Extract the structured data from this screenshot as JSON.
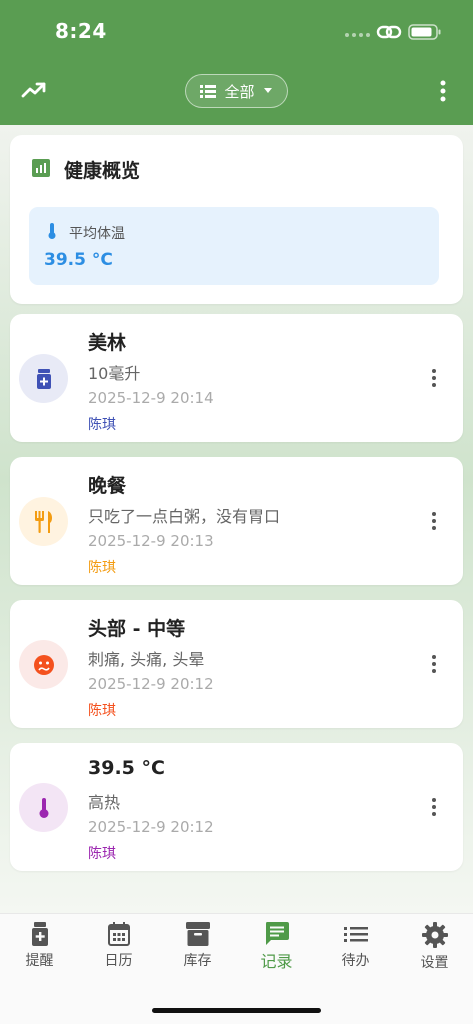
{
  "status_bar": {
    "time": "8:24"
  },
  "header": {
    "filter_label": "全部"
  },
  "overview": {
    "title": "健康概览",
    "avg_temp_label": "平均体温",
    "avg_temp_value": "39.5 °C"
  },
  "entries": [
    {
      "title": "美林",
      "desc": "10毫升",
      "time": "2025-12-9 20:14",
      "person": "陈琪",
      "icon": "medicine-bottle-icon",
      "color": "#3f51b5",
      "bg": "#e8eaf6"
    },
    {
      "title": "晚餐",
      "desc": "只吃了一点白粥，没有胃口",
      "time": "2025-12-9 20:13",
      "person": "陈琪",
      "icon": "utensils-icon",
      "color": "#f39c12",
      "bg": "#fff3e0"
    },
    {
      "title": "头部 - 中等",
      "desc": "刺痛, 头痛, 头晕",
      "time": "2025-12-9 20:12",
      "person": "陈琪",
      "icon": "sick-face-icon",
      "color": "#f4511e",
      "bg": "#fbe9e7"
    },
    {
      "title": "39.5 °C",
      "desc": "高热",
      "time": "2025-12-9 20:12",
      "person": "陈琪",
      "icon": "thermometer-icon",
      "color": "#9c27b0",
      "bg": "#f3e5f5"
    }
  ],
  "nav": [
    {
      "label": "提醒",
      "icon": "medicine-bottle-icon"
    },
    {
      "label": "日历",
      "icon": "calendar-icon"
    },
    {
      "label": "库存",
      "icon": "archive-box-icon"
    },
    {
      "label": "记录",
      "icon": "message-icon",
      "active": true
    },
    {
      "label": "待办",
      "icon": "list-icon"
    },
    {
      "label": "设置",
      "icon": "gear-icon"
    }
  ],
  "colors": {
    "brand": "#5a9d52",
    "active_nav": "#4f9a48",
    "temp_accent": "#2c8ee3"
  }
}
